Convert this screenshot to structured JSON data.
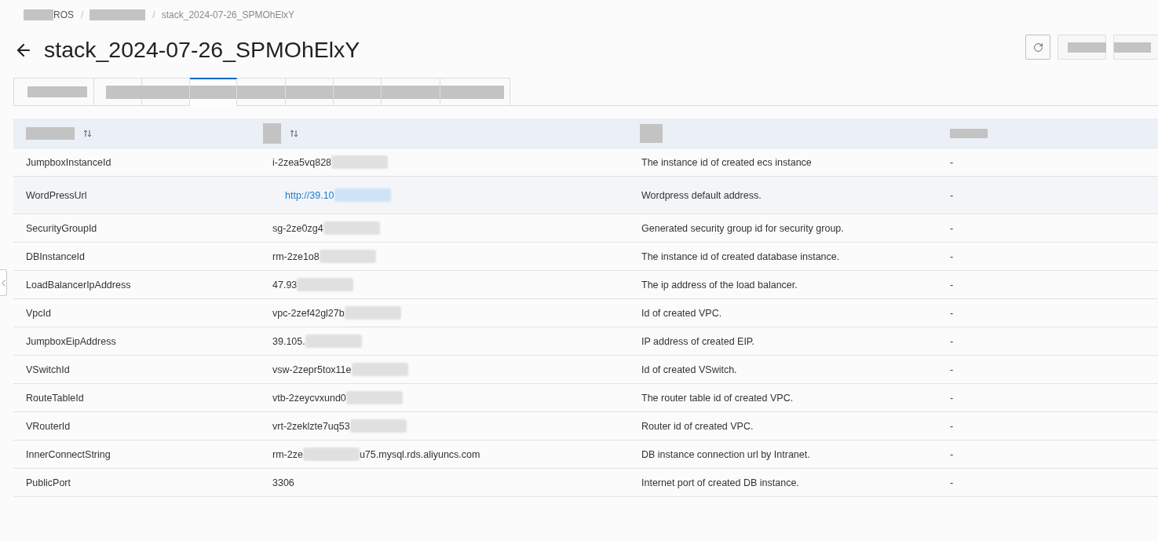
{
  "breadcrumb": [
    {
      "label": "ROS",
      "redacted": true
    },
    {
      "separator": "/",
      "redacted": true
    },
    {
      "separator": "/",
      "label": "stack_2024-07-26_SPMOhElxY"
    }
  ],
  "header": {
    "title": "stack_2024-07-26_SPMOhElxY",
    "actions_redacted": true
  },
  "tabs": {
    "redacted": true,
    "items": [
      {
        "selected": false
      },
      {
        "selected": false
      },
      {
        "selected": false
      },
      {
        "selected": true
      },
      {
        "selected": false
      },
      {
        "selected": false
      },
      {
        "selected": false
      },
      {
        "selected": false
      },
      {
        "selected": false
      }
    ]
  },
  "table": {
    "columns": [
      {
        "sortable": true,
        "redacted": true
      },
      {
        "sortable": true,
        "redacted": true
      },
      {
        "redacted": true
      },
      {
        "redacted": true
      }
    ],
    "rows": [
      {
        "name": "JumpboxInstanceId",
        "kind": "text",
        "value": "i-2zea5vq828",
        "blurred": true,
        "description": "The instance id of created ecs instance",
        "column_4": "-",
        "highlighted": false
      },
      {
        "name": "WordPressUrl",
        "kind": "link",
        "value": "http://39.10",
        "blurred": true,
        "description": "Wordpress default address.",
        "column_4": "-",
        "highlighted": true
      },
      {
        "name": "SecurityGroupId",
        "kind": "text",
        "value": "sg-2ze0zg4",
        "blurred": true,
        "description": "Generated security group id for security group.",
        "column_4": "-",
        "highlighted": false
      },
      {
        "name": "DBInstanceId",
        "kind": "text",
        "value": "rm-2ze1o8",
        "blurred": true,
        "description": "The instance id of created database instance.",
        "column_4": "-",
        "highlighted": false
      },
      {
        "name": "LoadBalancerIpAddress",
        "kind": "text",
        "value": "47.93",
        "blurred": true,
        "description": "The ip address of the load balancer.",
        "column_4": "-",
        "highlighted": false
      },
      {
        "name": "VpcId",
        "kind": "text",
        "value": "vpc-2zef42gl27b",
        "blurred": true,
        "description": "Id of created VPC.",
        "column_4": "-",
        "highlighted": false
      },
      {
        "name": "JumpboxEipAddress",
        "kind": "text",
        "value": "39.105.",
        "blurred": true,
        "description": "IP address of created EIP.",
        "column_4": "-",
        "highlighted": false
      },
      {
        "name": "VSwitchId",
        "kind": "text",
        "value": "vsw-2zepr5tox11e",
        "blurred": true,
        "description": "Id of created VSwitch.",
        "column_4": "-",
        "highlighted": false
      },
      {
        "name": "RouteTableId",
        "kind": "text",
        "value": "vtb-2zeycvxund0",
        "blurred": true,
        "description": "The router table id of created VPC.",
        "column_4": "-",
        "highlighted": false
      },
      {
        "name": "VRouterId",
        "kind": "text",
        "value": "vrt-2zeklzte7uq53",
        "blurred": true,
        "description": "Router id of created VPC.",
        "column_4": "-",
        "highlighted": false
      },
      {
        "name": "InnerConnectString",
        "kind": "text",
        "value": "rm-2ze",
        "blurred": true,
        "value_tail": "u75.mysql.rds.aliyuncs.com",
        "description": "DB instance connection url by Intranet.",
        "column_4": "-",
        "highlighted": false
      },
      {
        "name": "PublicPort",
        "kind": "text",
        "value": "3306",
        "blurred": false,
        "description": "Internet port of created DB instance.",
        "column_4": "-",
        "highlighted": false
      }
    ]
  }
}
